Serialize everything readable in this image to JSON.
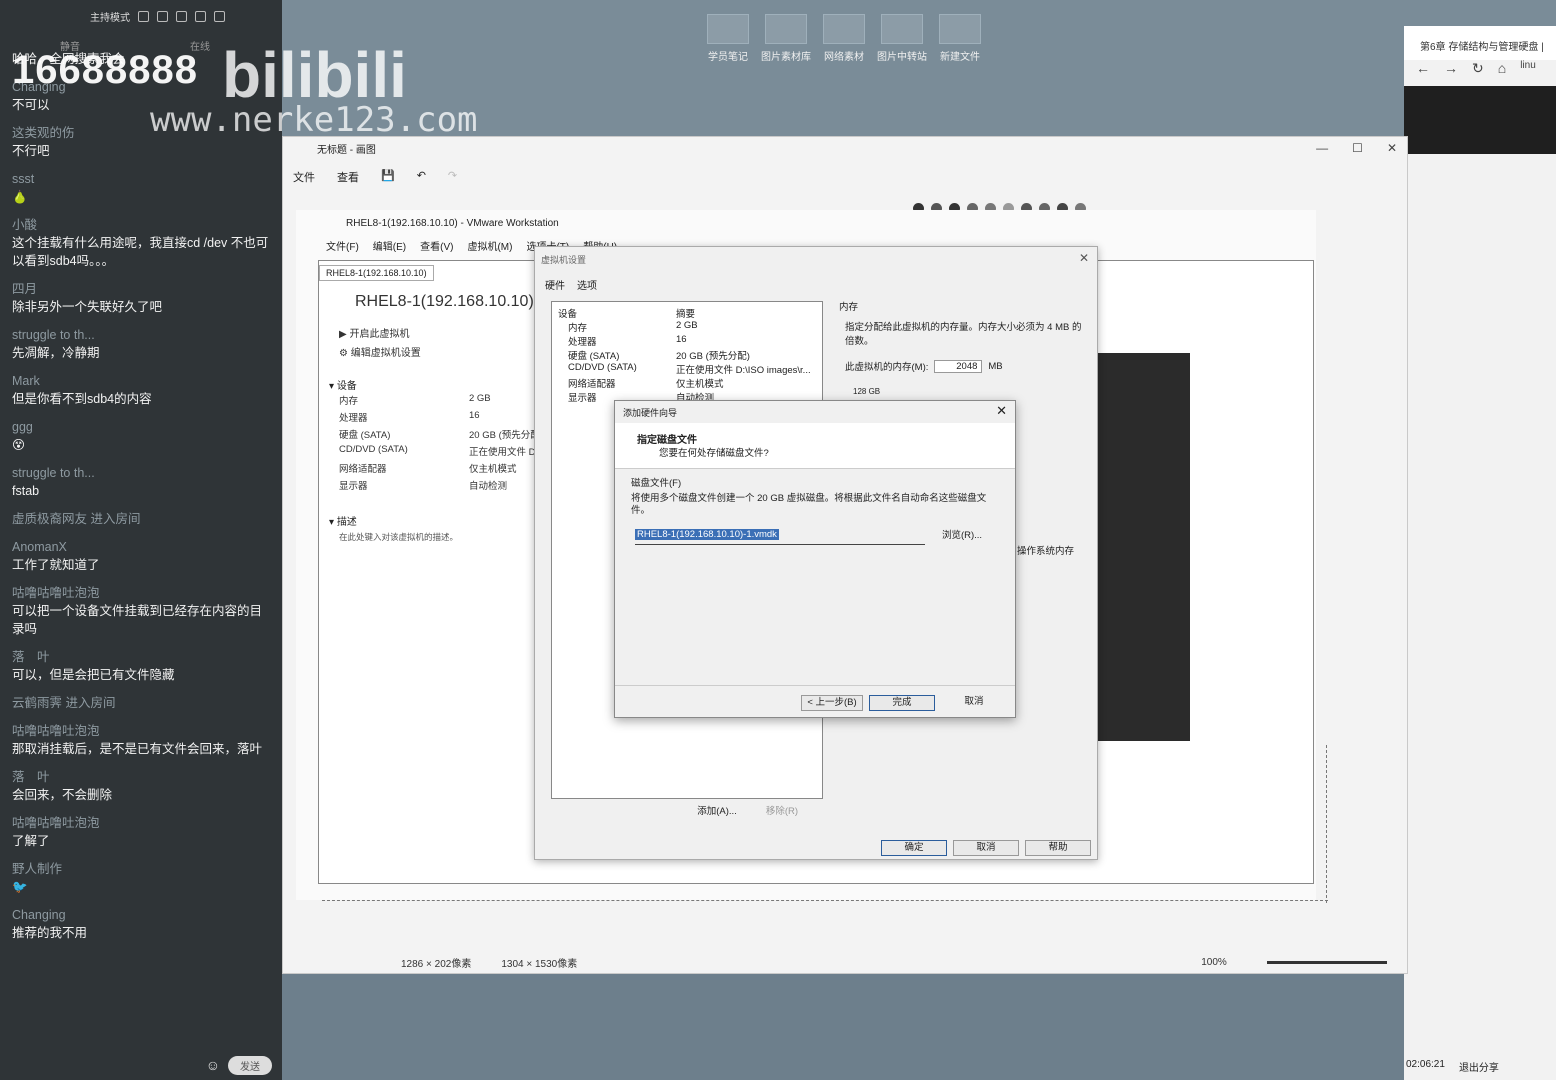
{
  "chat": {
    "mode_label": "主持模式",
    "tabs": [
      "静音",
      "在线"
    ],
    "watermark_number": "16688888",
    "watermark_logo": "bilibili",
    "watermark_url": "www.nerke123.com",
    "messages": [
      {
        "name": "",
        "text": "哈哈，全网搜索我会"
      },
      {
        "name": "Changing",
        "text": "不可以"
      },
      {
        "name": "这类观的伤",
        "text": "不行吧"
      },
      {
        "name": "ssst",
        "text": "🍐"
      },
      {
        "name": "小酸",
        "text": "这个挂载有什么用途呢，我直接cd /dev 不也可以看到sdb4吗。。。"
      },
      {
        "name": "四月",
        "text": "除非另外一个失联好久了吧"
      },
      {
        "name": "struggle to th...",
        "text": "先凋解，冷静期"
      },
      {
        "name": "Mark",
        "text": "但是你看不到sdb4的内容"
      },
      {
        "name": "ggg",
        "text": "😵"
      },
      {
        "name": "struggle to th...",
        "text": "fstab"
      },
      {
        "name": "虚质极裔网友 进入房间",
        "text": ""
      },
      {
        "name": "AnomanX",
        "text": "工作了就知道了"
      },
      {
        "name": "咕噜咕噜吐泡泡",
        "text": "可以把一个设备文件挂载到已经存在内容的目录吗"
      },
      {
        "name": "落　叶",
        "text": "可以，但是会把已有文件隐藏"
      },
      {
        "name": "云鹤雨霁 进入房间",
        "text": ""
      },
      {
        "name": "咕噜咕噜吐泡泡",
        "text": "那取消挂载后，是不是已有文件会回来，落叶"
      },
      {
        "name": "落　叶",
        "text": "会回来，不会删除"
      },
      {
        "name": "咕噜咕噜吐泡泡",
        "text": "了解了"
      },
      {
        "name": "野人制作",
        "text": "🐦"
      },
      {
        "name": "Changing",
        "text": "推荐的我不用"
      }
    ],
    "send_label": "发送"
  },
  "desktop_icons": [
    "学员笔记",
    "图片素材库",
    "网络素材",
    "图片中转站",
    "新建文件"
  ],
  "browser": {
    "tab_title": "第6章 存储结构与管理硬盘 |",
    "url_fragment": "linu",
    "time": "02:06:21",
    "share_label": "退出分享"
  },
  "paint": {
    "title": "无标题 - 画图",
    "menu": [
      "文件",
      "查看"
    ],
    "status_selection": "1286 × 202像素",
    "status_canvas": "1304 × 1530像素",
    "zoom": "100%"
  },
  "vmware": {
    "title": "RHEL8-1(192.168.10.10) - VMware Workstation",
    "menu": [
      "文件(F)",
      "编辑(E)",
      "查看(V)",
      "虚拟机(M)",
      "选项卡(T)",
      "帮助(H)"
    ],
    "tab_label": "RHEL8-1(192.168.10.10)",
    "vm_name": "RHEL8-1(192.168.10.10)",
    "actions": [
      "开启此虚拟机",
      "编辑虚拟机设置"
    ],
    "devices_header": "设备",
    "devices": [
      {
        "name": "内存",
        "value": "2 GB"
      },
      {
        "name": "处理器",
        "value": "16"
      },
      {
        "name": "硬盘 (SATA)",
        "value": "20 GB (预先分配)"
      },
      {
        "name": "CD/DVD (SATA)",
        "value": "正在使用文件 D:"
      },
      {
        "name": "网络适配器",
        "value": "仅主机模式"
      },
      {
        "name": "显示器",
        "value": "自动检测"
      }
    ],
    "desc_header": "描述",
    "desc_text": "在此处键入对该虚拟机的描述。"
  },
  "settings": {
    "title": "虚拟机设置",
    "tabs": [
      "硬件",
      "选项"
    ],
    "col_device": "设备",
    "col_summary": "摘要",
    "rows": [
      {
        "name": "内存",
        "value": "2 GB"
      },
      {
        "name": "处理器",
        "value": "16"
      },
      {
        "name": "硬盘 (SATA)",
        "value": "20 GB (预先分配)"
      },
      {
        "name": "CD/DVD (SATA)",
        "value": "正在使用文件 D:\\ISO images\\r..."
      },
      {
        "name": "网络适配器",
        "value": "仅主机模式"
      },
      {
        "name": "显示器",
        "value": "自动检测"
      }
    ],
    "right_title": "内存",
    "right_desc": "指定分配给此虚拟机的内存量。内存大小必须为 4 MB 的倍数。",
    "mem_label": "此虚拟机的内存(M):",
    "mem_value": "2048",
    "mem_unit": "MB",
    "scale_label": "128 GB",
    "guest_mem_label": "操作系统内存",
    "add_btn": "添加(A)...",
    "remove_btn": "移除(R)",
    "ok_btn": "确定",
    "cancel_btn": "取消",
    "help_btn": "帮助"
  },
  "wizard": {
    "title": "添加硬件向导",
    "heading": "指定磁盘文件",
    "subheading": "您要在何处存储磁盘文件?",
    "field_label": "磁盘文件(F)",
    "field_desc": "将使用多个磁盘文件创建一个 20 GB 虚拟磁盘。将根据此文件名自动命名这些磁盘文件。",
    "path_value": "RHEL8-1(192.168.10.10)-1.vmdk",
    "browse_btn": "浏览(R)...",
    "back_btn": "< 上一步(B)",
    "finish_btn": "完成",
    "cancel_btn": "取消"
  }
}
